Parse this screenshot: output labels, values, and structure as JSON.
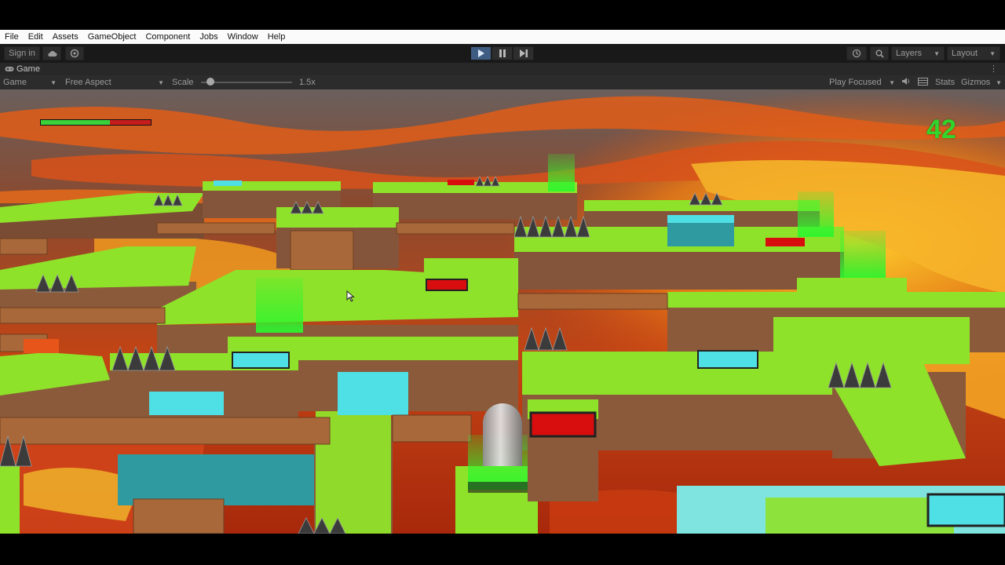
{
  "menu": [
    "File",
    "Edit",
    "Assets",
    "GameObject",
    "Component",
    "Jobs",
    "Window",
    "Help"
  ],
  "toolbar": {
    "sign_in_label": "Sign in",
    "cloud_icon": "cloud-icon",
    "services_icon": "collab-icon",
    "play_icon": "play-icon",
    "pause_icon": "pause-icon",
    "step_icon": "step-icon",
    "history_icon": "history-icon",
    "search_icon": "search-icon",
    "layers_label": "Layers",
    "layout_label": "Layout",
    "play_active_color": "#3f5d82"
  },
  "tab": {
    "label": "Game",
    "icon": "gamepad-icon"
  },
  "gamebar": {
    "display_label": "Game",
    "aspect_label": "Free Aspect",
    "scale_label": "Scale",
    "scale_value": "1.5x",
    "scale_fraction": 0.1,
    "play_mode_label": "Play Focused",
    "stats_label": "Stats",
    "gizmos_label": "Gizmos"
  },
  "hud": {
    "health_fraction": 0.63,
    "health_color": "#3ad13a",
    "health_bg_color": "#c61c1c",
    "score": "42",
    "score_color": "#32d52c"
  },
  "scene_colors": {
    "lava": "#e85a10",
    "rock": "#5a5656",
    "grass_top": "#8fe22a",
    "dirt_side": "#8a5a3a",
    "wood_bridge": "#a8683a",
    "ice_tile": "#4fe0e6",
    "trap_tile": "#d80e0e",
    "checkpoint_glow": "#2ef52e"
  }
}
